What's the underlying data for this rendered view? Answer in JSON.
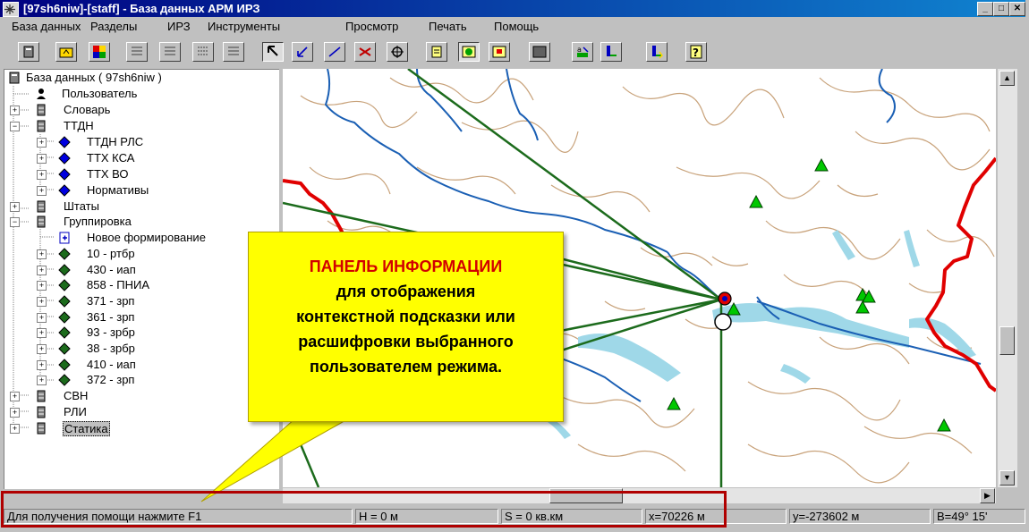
{
  "window": {
    "title": "[97sh6niw]-[staff] - База данных АРМ ИРЗ",
    "buttons": [
      "_",
      "□",
      "✕"
    ]
  },
  "menu": [
    "База данных",
    "Разделы",
    "ИРЗ",
    "Инструменты",
    "Просмотр",
    "Печать",
    "Помощь"
  ],
  "toolbar": {
    "buttons": [
      "database-icon",
      "folder-icon",
      "color-icon",
      "grid-icon",
      "grid-icon",
      "grid-icon",
      "grid-icon",
      "pointer-icon",
      "arrow-icon",
      "line-icon",
      "route-icon",
      "target-icon",
      "page-icon",
      "map-view-icon",
      "window-icon",
      "rectangle-icon",
      "text-icon",
      "chart-icon",
      "print-icon",
      "help-icon"
    ]
  },
  "tree": {
    "root": "База данных ( 97sh6niw )",
    "user": "Пользователь",
    "dictionary": "Словарь",
    "ttdn": {
      "label": "ТТДН",
      "children": [
        "ТТДН РЛС",
        "ТТХ КСА",
        "ТТХ ВО",
        "Нормативы"
      ]
    },
    "shtaty": "Штаты",
    "grouping": {
      "label": "Группировка",
      "new": "Новое формирование",
      "children": [
        "10 - ртбр",
        "430 - иап",
        "858 - ПНИА",
        "371 - зрп",
        "361 - зрп",
        "93 - зрбр",
        "38 - зрбр",
        "410 - иап",
        "372 - зрп"
      ]
    },
    "svn": "СВН",
    "rli": "РЛИ",
    "static": "Статика"
  },
  "callout": {
    "title": "ПАНЕЛЬ ИНФОРМАЦИИ",
    "lines": [
      "для отображения",
      "контекстной подсказки или",
      "расшифровки выбранного",
      "пользователем режима."
    ]
  },
  "status": {
    "help": "Для получения помощи нажмите F1",
    "h": "H = 0 м",
    "s": "S = 0  кв.км",
    "x": "x=70226 м",
    "y": "y=-273602 м",
    "b": "B=49° 15'"
  },
  "colors": {
    "river": "#1a5fb4",
    "relief": "#c8a27a",
    "lake": "#9fd8e8",
    "border": "#e00000",
    "rays": "#1c6b1c",
    "marker": "#00c800",
    "callout": "#ffff00"
  }
}
